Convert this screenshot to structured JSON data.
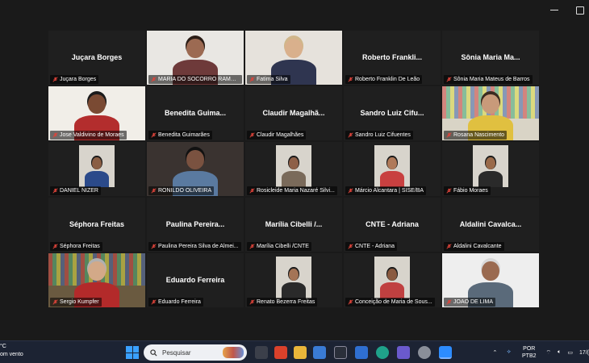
{
  "tiles": [
    {
      "id": "t1",
      "name": "Juçara Borges",
      "label": "Juçara Borges",
      "video": false
    },
    {
      "id": "t2",
      "name": "",
      "label": "MARIA DO SOCORRO RAMAL...",
      "video": true
    },
    {
      "id": "t3",
      "name": "",
      "label": "Fatima Silva",
      "video": true
    },
    {
      "id": "t4",
      "name": "Roberto Frankli...",
      "label": "Roberto Franklin De Leão",
      "video": false
    },
    {
      "id": "t5",
      "name": "Sônia Maria Ma...",
      "label": "Sônia Maria Mateus de Barros",
      "video": false
    },
    {
      "id": "t6",
      "name": "",
      "label": "Jose Valdivino de Moraes",
      "video": true,
      "active": true
    },
    {
      "id": "t7",
      "name": "Benedita Guima...",
      "label": "Benedita Guimarães",
      "video": false
    },
    {
      "id": "t8",
      "name": "Claudir Magalhã...",
      "label": "Claudir Magalhães",
      "video": false
    },
    {
      "id": "t9",
      "name": "Sandro Luiz Cifu...",
      "label": "Sandro Luiz Cifuentes",
      "video": false
    },
    {
      "id": "t10",
      "name": "",
      "label": "Rosana Nascimento",
      "video": true
    },
    {
      "id": "t11",
      "name": "",
      "label": "DANIEL NIZER",
      "video": true
    },
    {
      "id": "t12",
      "name": "",
      "label": "RONILDO OLIVEIRA",
      "video": true
    },
    {
      "id": "t13",
      "name": "",
      "label": "Rosicleide Maria Nazaré Silvi...",
      "video": true
    },
    {
      "id": "t14",
      "name": "",
      "label": "Márcio Alcantara | SISE/BA",
      "video": true
    },
    {
      "id": "t15",
      "name": "",
      "label": "Fábio Moraes",
      "video": true
    },
    {
      "id": "t16",
      "name": "Séphora Freitas",
      "label": "Séphora Freitas",
      "video": false
    },
    {
      "id": "t17",
      "name": "Paulina Pereira...",
      "label": "Paulina Pereira Silva de Almei...",
      "video": false
    },
    {
      "id": "t18",
      "name": "Marília Cibelli /...",
      "label": "Marília Cibelli /CNTE",
      "video": false
    },
    {
      "id": "t19",
      "name": "CNTE - Adriana",
      "label": "CNTE - Adriana",
      "video": false
    },
    {
      "id": "t20",
      "name": "Aldalini Cavalca...",
      "label": "Aldalini Cavalcante",
      "video": false
    },
    {
      "id": "t21",
      "name": "",
      "label": "Sergio Kumpfer",
      "video": true
    },
    {
      "id": "t22",
      "name": "Eduardo Ferreira",
      "label": "Eduardo Ferreira",
      "video": false
    },
    {
      "id": "t23",
      "name": "",
      "label": "Renato Bezerra Freitas",
      "video": true
    },
    {
      "id": "t24",
      "name": "",
      "label": "Conceição de Maria de Sous...",
      "video": true
    },
    {
      "id": "t25",
      "name": "",
      "label": "JOAO DE LIMA",
      "video": true
    }
  ],
  "taskbar": {
    "weather_temp": "°C",
    "weather_desc": "om vento",
    "search_placeholder": "Pesquisar",
    "lang_line1": "POR",
    "lang_line2": "PTB2",
    "date": "17/("
  },
  "colors": {
    "active_speaker": "#23d959",
    "mic_muted": "#e0443a",
    "tile_bg": "#1f1f1f"
  }
}
